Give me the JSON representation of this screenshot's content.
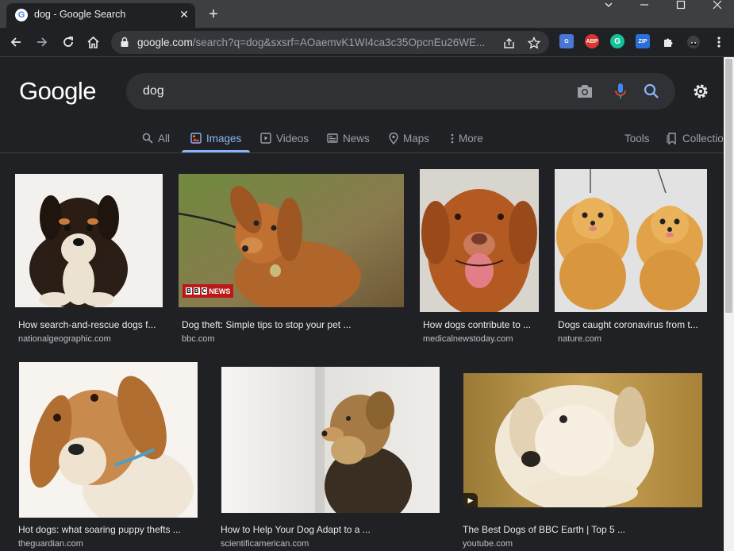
{
  "browser": {
    "tab_title": "dog - Google Search",
    "tab_close": "✕",
    "new_tab": "+",
    "window_controls": [
      "minimize-icon",
      "maximize-icon",
      "close-icon"
    ],
    "url_host": "google.com",
    "url_path": "/search?q=dog&sxsrf=AOaemvK1WI4ca3c35OpcnEu26WE...",
    "extensions": [
      {
        "name": "google-translate-extension-icon",
        "label": "G",
        "color": "#4a76d6"
      },
      {
        "name": "adblock-plus-extension-icon",
        "label": "ABP",
        "color": "#d9362e"
      },
      {
        "name": "grammarly-extension-icon",
        "label": "G",
        "color": "#15c39a"
      },
      {
        "name": "zip-extension-icon",
        "label": "ZIP",
        "color": "#2c6fd6"
      }
    ]
  },
  "google": {
    "logo": "Google",
    "query": "dog",
    "tabs": [
      {
        "label": "All",
        "icon": "search-icon"
      },
      {
        "label": "Images",
        "icon": "image-icon",
        "active": true
      },
      {
        "label": "Videos",
        "icon": "play-icon"
      },
      {
        "label": "News",
        "icon": "news-icon"
      },
      {
        "label": "Maps",
        "icon": "pin-icon"
      },
      {
        "label": "More",
        "icon": "more-vert-icon"
      }
    ],
    "tools": "Tools",
    "collections": "Collectio"
  },
  "results": [
    {
      "title": "How search-and-rescue dogs f...",
      "source": "nationalgeographic.com"
    },
    {
      "title": "Dog theft: Simple tips to stop your pet ...",
      "source": "bbc.com",
      "badge": "NEWS"
    },
    {
      "title": "How dogs contribute to ...",
      "source": "medicalnewstoday.com"
    },
    {
      "title": "Dogs caught coronavirus from t...",
      "source": "nature.com"
    },
    {
      "title": "Hot dogs: what soaring puppy thefts ...",
      "source": "theguardian.com"
    },
    {
      "title": "How to Help Your Dog Adapt to a ...",
      "source": "scientificamerican.com"
    },
    {
      "title": "The Best Dogs of BBC Earth | Top 5 ...",
      "source": "youtube.com"
    }
  ],
  "colors": {
    "accent": "#8ab4f8",
    "background": "#202124",
    "searchbox": "#303134"
  }
}
